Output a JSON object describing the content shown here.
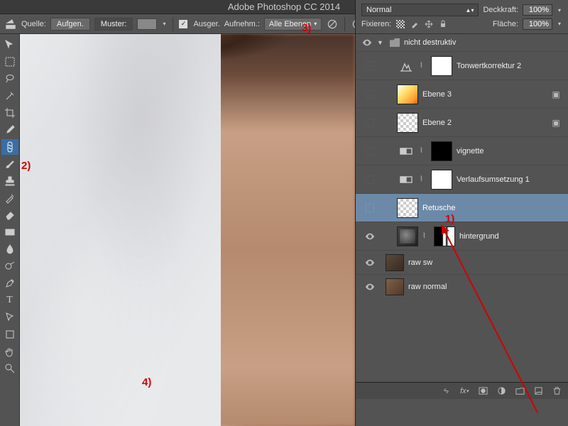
{
  "title": "Adobe Photoshop CC 2014",
  "options": {
    "source_lbl": "Quelle:",
    "sampled_btn": "Aufgen.",
    "pattern_btn": "Muster:",
    "aligned_lbl": "Ausger.",
    "sample_lbl": "Aufnehm.:",
    "sample_val": "Alle Ebenen"
  },
  "rpanel": {
    "blend_mode": "Normal",
    "opacity_lbl": "Deckkraft:",
    "opacity_val": "100%",
    "lock_lbl": "Fixieren:",
    "fill_lbl": "Fläche:",
    "fill_val": "100%"
  },
  "group": {
    "name": "nicht destruktiv"
  },
  "layers": [
    {
      "name": "Tonwertkorrektur 2",
      "type": "levels",
      "mask": "white"
    },
    {
      "name": "Ebene 3",
      "type": "layer",
      "thumb": "grad-or",
      "propagate": true
    },
    {
      "name": "Ebene 2",
      "type": "layer",
      "thumb": "checker",
      "propagate": true
    },
    {
      "name": "vignette",
      "type": "gmap",
      "mask": "black"
    },
    {
      "name": "Verlaufsumsetzung 1",
      "type": "gmap2",
      "mask": "white"
    },
    {
      "name": "Retusche",
      "type": "layer",
      "thumb": "checker",
      "selected": true
    },
    {
      "name": "hintergrund",
      "type": "layer",
      "thumb": "photo-th",
      "mask": "maskA",
      "linked": true
    },
    {
      "name": "raw sw",
      "type": "smart",
      "thumb": "raw",
      "narrow": true
    },
    {
      "name": "raw normal",
      "type": "smart",
      "thumb": "rawn",
      "narrow": true
    }
  ],
  "anno": {
    "a1": "1)",
    "a2": "2)",
    "a3": "3)",
    "a4": "4)"
  }
}
